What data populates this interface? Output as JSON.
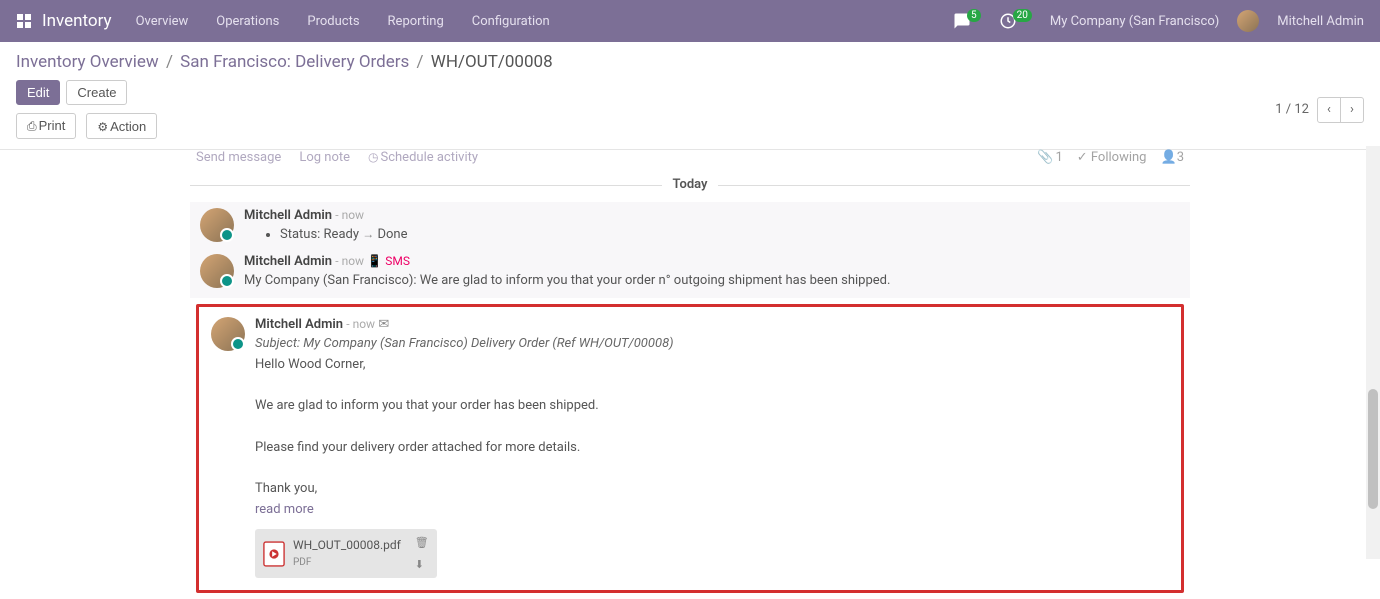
{
  "header": {
    "app_name": "Inventory",
    "menu": [
      "Overview",
      "Operations",
      "Products",
      "Reporting",
      "Configuration"
    ],
    "chat_badge": "5",
    "activity_badge": "20",
    "company": "My Company (San Francisco)",
    "user": "Mitchell Admin"
  },
  "breadcrumb": {
    "l1": "Inventory Overview",
    "l2": "San Francisco: Delivery Orders",
    "l3": "WH/OUT/00008"
  },
  "buttons": {
    "edit": "Edit",
    "create": "Create",
    "print": "Print",
    "action": "Action"
  },
  "pager": {
    "current": "1",
    "total": "12"
  },
  "chatter": {
    "send": "Send message",
    "log": "Log note",
    "schedule": "Schedule activity",
    "attach_count": "1",
    "following": "Following",
    "followers": "3",
    "today": "Today"
  },
  "messages": [
    {
      "author": "Mitchell Admin",
      "time": "- now",
      "status_prefix": "Status: Ready",
      "status_suffix": "Done"
    },
    {
      "author": "Mitchell Admin",
      "time": "- now",
      "sms": "SMS",
      "body": "My Company (San Francisco): We are glad to inform you that your order n° outgoing shipment has been shipped."
    },
    {
      "author": "Mitchell Admin",
      "time": "- now",
      "subject": "Subject: My Company (San Francisco) Delivery Order (Ref WH/OUT/00008)",
      "line1": "Hello Wood Corner,",
      "line2": "We are glad to inform you that your order has been shipped.",
      "line3": "Please find your delivery order attached for more details.",
      "line4": "Thank you,",
      "read_more": "read more",
      "attachment": {
        "name": "WH_OUT_00008.pdf",
        "ext": "PDF"
      }
    }
  ]
}
